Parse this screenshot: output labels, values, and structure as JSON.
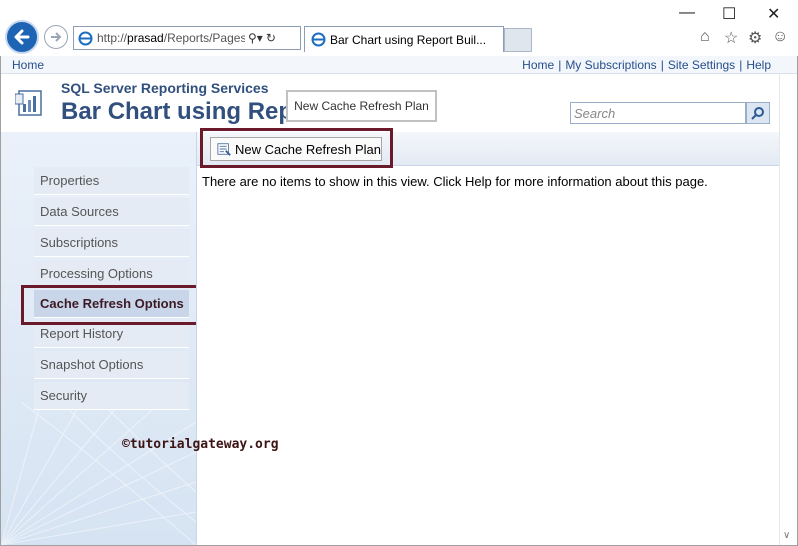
{
  "browser": {
    "address": {
      "prefix": "http://",
      "host": "prasad",
      "path": "/Reports/Pages"
    },
    "tab_title": "Bar Chart using Report Buil...",
    "window_controls": [
      "minimize",
      "maximize",
      "close"
    ],
    "toolbar_icons": [
      "home-icon",
      "star-icon",
      "gear-icon",
      "smiley-icon"
    ]
  },
  "ssrs": {
    "top_home": "Home",
    "top_links": [
      "Home",
      "My Subscriptions",
      "Site Settings",
      "Help"
    ],
    "separator": "|",
    "app_name": "SQL Server Reporting Services",
    "page_title": "Bar Chart using Rep",
    "tooltip": "New Cache Refresh Plan",
    "search_placeholder": "Search"
  },
  "leftnav": {
    "items": [
      {
        "label": "Properties",
        "selected": false
      },
      {
        "label": "Data Sources",
        "selected": false
      },
      {
        "label": "Subscriptions",
        "selected": false
      },
      {
        "label": "Processing Options",
        "selected": false
      },
      {
        "label": "Cache Refresh Options",
        "selected": true
      },
      {
        "label": "Report History",
        "selected": false
      },
      {
        "label": "Snapshot Options",
        "selected": false
      },
      {
        "label": "Security",
        "selected": false
      }
    ]
  },
  "content": {
    "toolbar_button": "New Cache Refresh Plan",
    "empty_message": "There are no items to show in this view. Click Help for more information about this page."
  },
  "watermark": "©tutorialgateway.org",
  "colors": {
    "accent": "#31507e",
    "highlight_border": "#6b1a2b",
    "link": "#264f8e"
  }
}
